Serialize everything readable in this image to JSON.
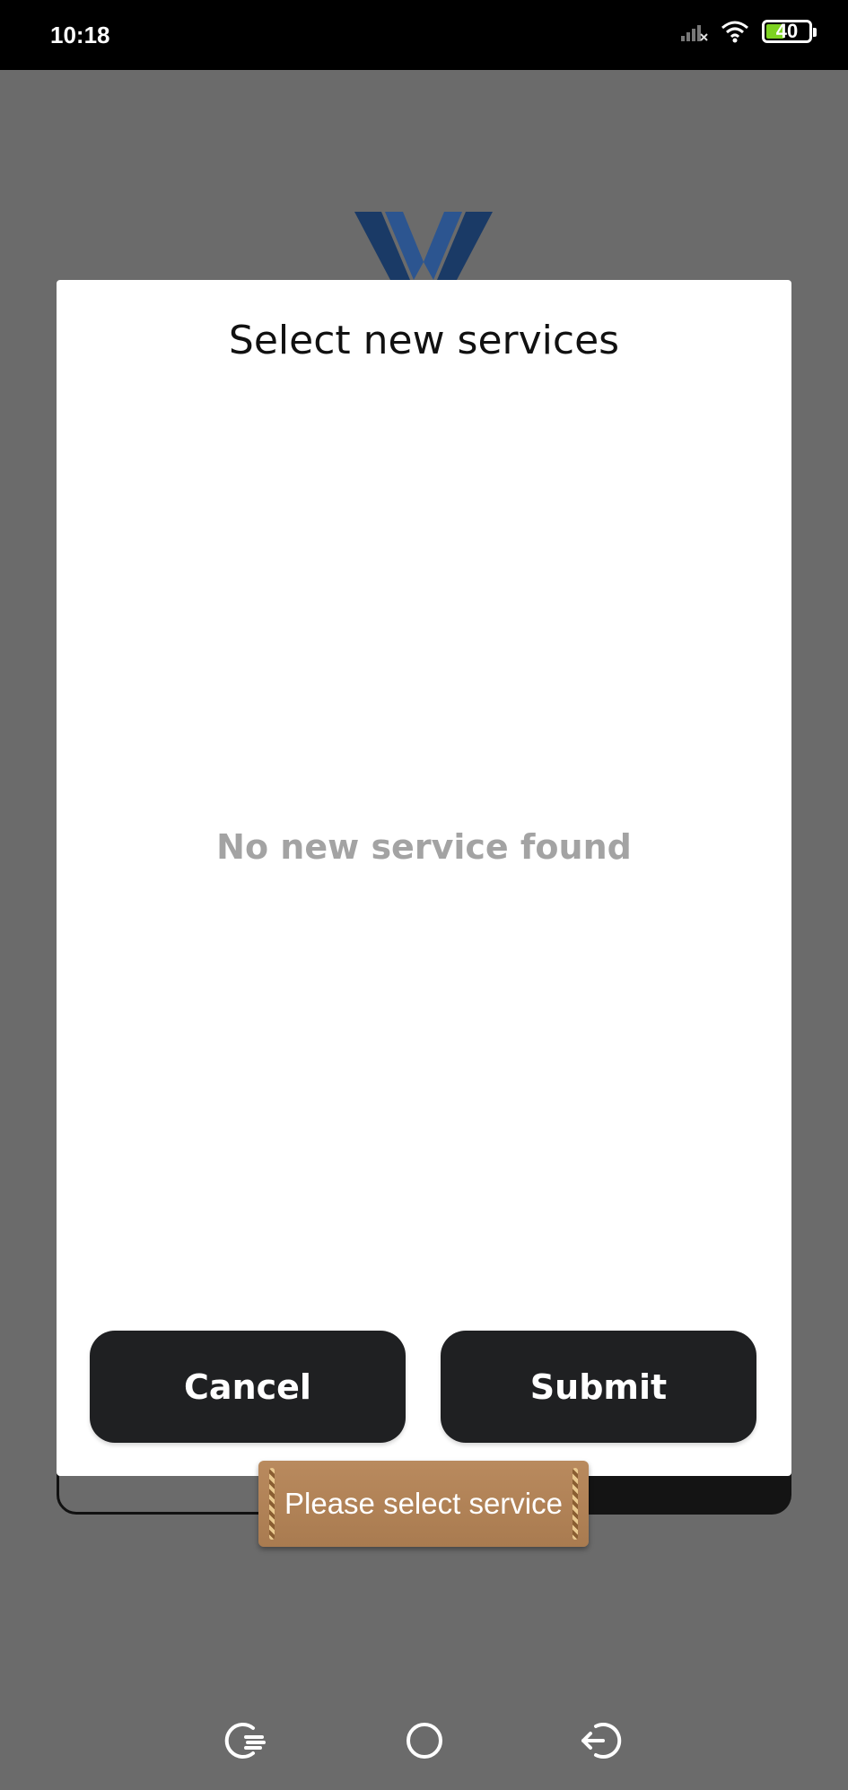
{
  "status_bar": {
    "time": "10:18",
    "battery_level": "40",
    "icons": [
      "signal-icon",
      "wifi-icon",
      "battery-icon"
    ]
  },
  "dialog": {
    "title": "Select new services",
    "empty_message": "No new service found",
    "cancel_label": "Cancel",
    "submit_label": "Submit"
  },
  "toast": {
    "message": "Please select service"
  },
  "nav_bar": {
    "icons": [
      "recent-apps-icon",
      "home-icon",
      "back-icon"
    ]
  },
  "colors": {
    "overlay_background": "#6b6b6b",
    "button_background": "#1f2022",
    "toast_background": "#b0814f",
    "empty_text": "#a3a3a3",
    "logo_blue": "#1f3f6e"
  }
}
